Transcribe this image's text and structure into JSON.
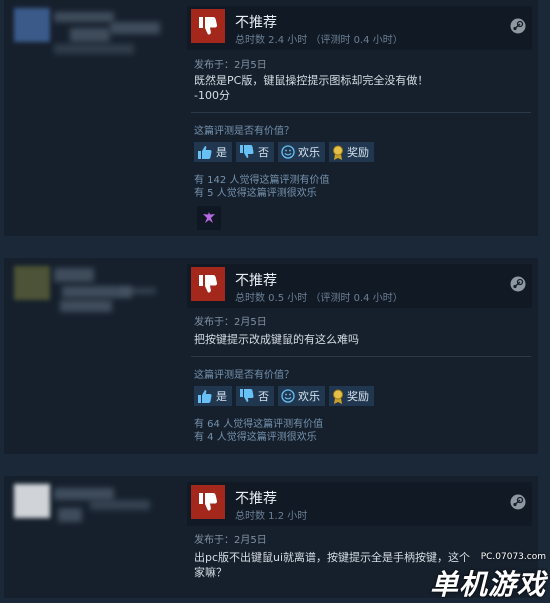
{
  "reviews": [
    {
      "verdict": "不推荐",
      "hours": "总时数 2.4 小时  （评测时 0.4 小时）",
      "posted": "发布于：2月5日",
      "lines": [
        "既然是PC版，键鼠操控提示图标却完全没有做！",
        "-100分"
      ],
      "helpful_question": "这篇评测是否有价值？",
      "buttons": {
        "yes": "是",
        "no": "否",
        "funny": "欢乐",
        "award": "奖励"
      },
      "helpful_count": "有 142 人觉得这篇评测有价值",
      "funny_count": "有 5 人觉得这篇评测很欢乐"
    },
    {
      "verdict": "不推荐",
      "hours": "总时数 0.5 小时  （评测时 0.4 小时）",
      "posted": "发布于：2月5日",
      "lines": [
        "把按键提示改成键鼠的有这么难吗"
      ],
      "helpful_question": "这篇评测是否有价值？",
      "buttons": {
        "yes": "是",
        "no": "否",
        "funny": "欢乐",
        "award": "奖励"
      },
      "helpful_count": "有 64 人觉得这篇评测有价值",
      "funny_count": "有 4 人觉得这篇评测很欢乐"
    },
    {
      "verdict": "不推荐",
      "hours": "总时数 1.2 小时",
      "posted": "发布于：2月5日",
      "lines": [
        "出pc版不出键鼠ui就离谱，按键提示全是手柄按键，这个",
        "家嘛？"
      ]
    }
  ],
  "watermark": {
    "url": "PC.07073.com",
    "text": "单机游戏"
  }
}
